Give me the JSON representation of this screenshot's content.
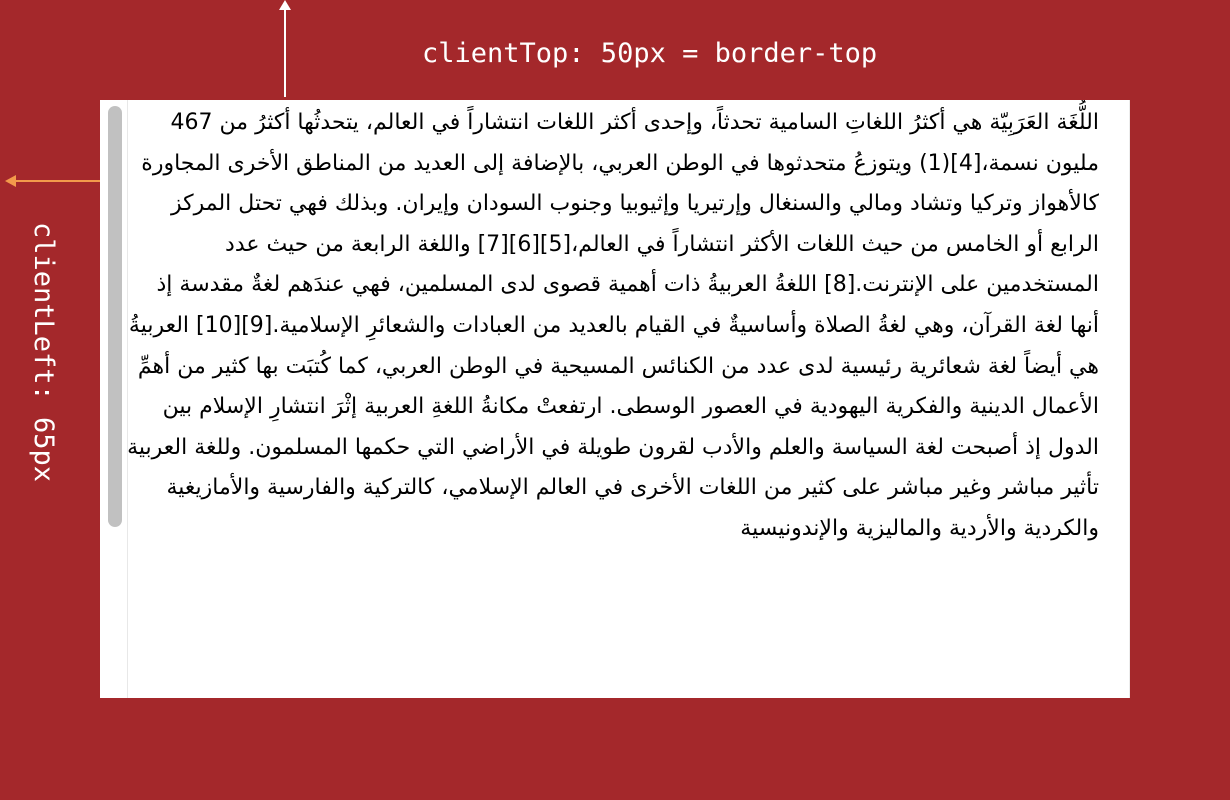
{
  "annotations": {
    "top_label": "clientTop: 50px = border-top",
    "left_label": "clientLeft: 65px"
  },
  "colors": {
    "background": "#A4282B",
    "box": "#FFFFFF",
    "top_arrow": "#FFFFFF",
    "left_arrow": "#F39A4B",
    "scrollbar_thumb": "#C1C1C1"
  },
  "content": {
    "paragraph": "اللُّغَة العَرَبِيّة هي أكثرُ اللغاتِ السامية تحدثاً، وإحدى أكثر اللغات انتشاراً في العالم، يتحدثُها أكثرُ من 467 مليون نسمة،[4](1) ويتوزعُ متحدثوها في الوطن العربي، بالإضافة إلى العديد من المناطق الأخرى المجاورة كالأهواز وتركيا وتشاد ومالي والسنغال وإرتيريا وإثيوبيا وجنوب السودان وإيران. وبذلك فهي تحتل المركز الرابع أو الخامس من حيث اللغات الأكثر انتشاراً في العالم،[5][6][7] واللغة الرابعة من حيث عدد المستخدمين على الإنترنت.[8] اللغةُ العربيةُ ذات أهمية قصوى لدى المسلمين، فهي عندَهم لغةٌ مقدسة إذ أنها لغة القرآن، وهي لغةُ الصلاة وأساسيةٌ في القيام بالعديد من العبادات والشعائرِ الإسلامية.[9][10] العربيةُ هي أيضاً لغة شعائرية رئيسية لدى عدد من الكنائس المسيحية في الوطن العربي، كما كُتبَت بها كثير من أهمِّ الأعمال الدينية والفكرية اليهودية في العصور الوسطى. ارتفعتْ مكانةُ اللغةِ العربية إثْرَ انتشارِ الإسلام بين الدول إذ أصبحت لغة السياسة والعلم والأدب لقرون طويلة في الأراضي التي حكمها المسلمون. وللغة العربية تأثير مباشر وغير مباشر على كثير من اللغات الأخرى في العالم الإسلامي، كالتركية والفارسية والأمازيغية والكردية والأردية والماليزية والإندونيسية"
  }
}
